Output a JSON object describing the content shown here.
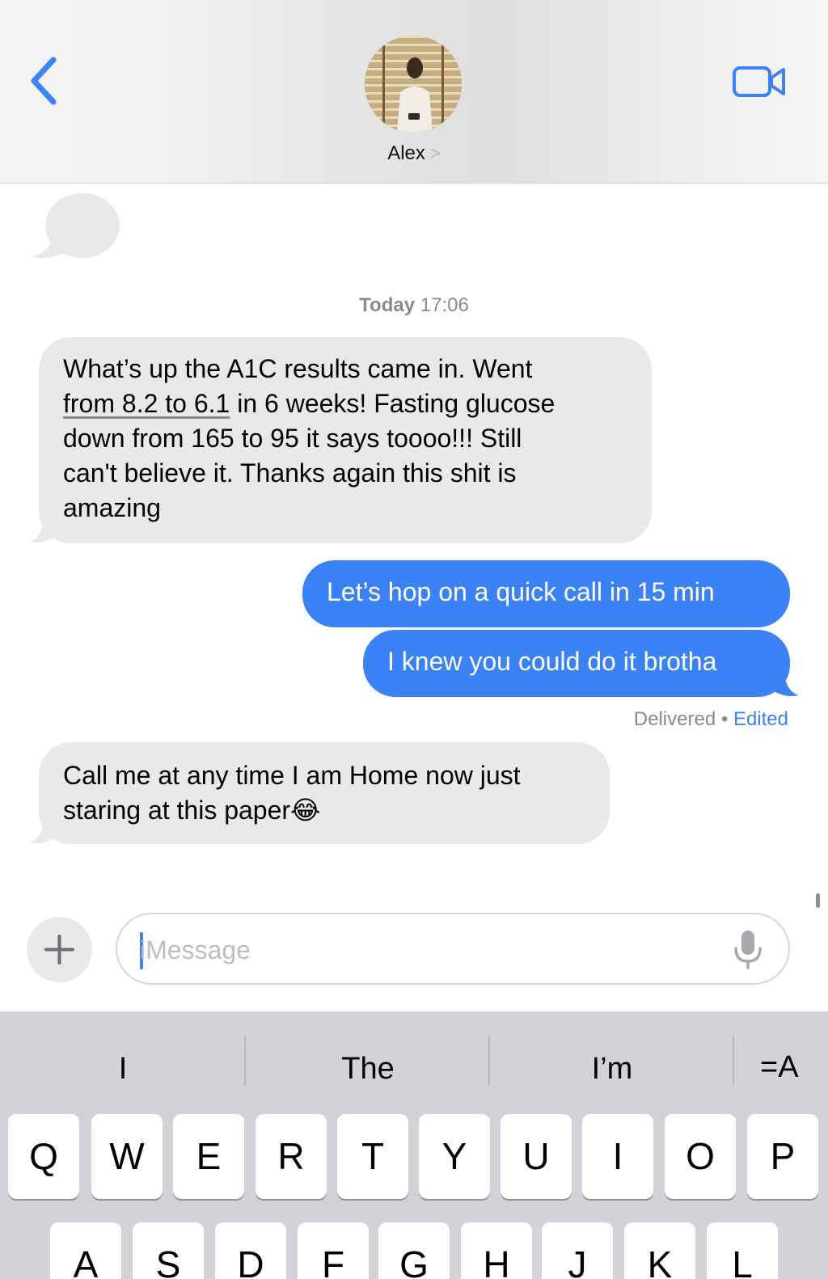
{
  "header": {
    "contact_name": "Alex",
    "name_chevron": ">",
    "accent": "#3a82f6",
    "back_icon": "chevron-left-icon",
    "video_icon": "video-camera-icon"
  },
  "conversation": {
    "timestamp_day": "Today",
    "timestamp_time": "17:06",
    "incoming_color": "#e9e9eb",
    "outgoing_color": "#3a82f6",
    "messages": [
      {
        "direction": "incoming",
        "lines": [
          "What’s up the  A1C results came in. Went",
          "from 8.2 to 6.1",
          " in 6 weeks! Fasting glucose",
          "down from 165 to 95 it says toooo!!! Still",
          "can't believe it. Thanks again this shit is",
          "amazing"
        ]
      },
      {
        "direction": "outgoing",
        "text": "Let’s hop on a quick call in 15 min"
      },
      {
        "direction": "outgoing",
        "text": "I knew you could do it brotha"
      },
      {
        "direction": "incoming",
        "lines": [
          "Call me at any time I am Home now just",
          "staring at this paper"
        ],
        "emoji": "😂"
      }
    ],
    "status": {
      "delivered": "Delivered",
      "separator": "•",
      "edited": "Edited"
    }
  },
  "composer": {
    "plus_label": "+",
    "placeholder": "iMessage",
    "mic_icon": "microphone-icon"
  },
  "keyboard": {
    "suggestions": [
      "I",
      "The",
      "I’m"
    ],
    "format_button": "=A",
    "row1": [
      "Q",
      "W",
      "E",
      "R",
      "T",
      "Y",
      "U",
      "I",
      "O",
      "P"
    ],
    "row2": [
      "A",
      "S",
      "D",
      "F",
      "G",
      "H",
      "J",
      "K",
      "L"
    ]
  }
}
